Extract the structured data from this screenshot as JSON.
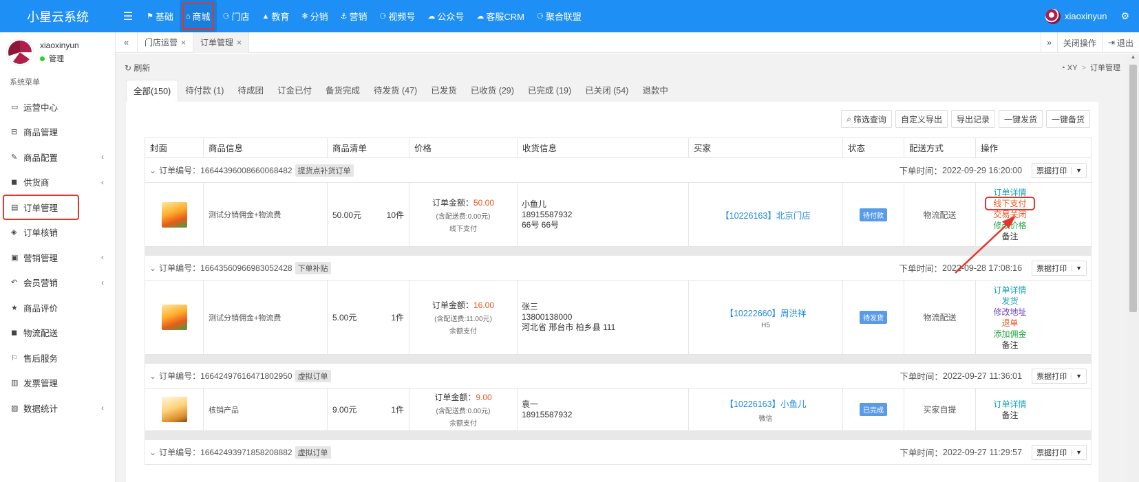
{
  "app": {
    "title": "小星云系统"
  },
  "topnav": [
    {
      "icon": "bookmark-icon",
      "glyph": "⚑",
      "label": "基础",
      "active": false
    },
    {
      "icon": "shop-icon",
      "glyph": "⌂",
      "label": "商城",
      "active": true
    },
    {
      "icon": "sitemap-icon",
      "glyph": "⚆",
      "label": "门店",
      "active": false
    },
    {
      "icon": "graduation-cap-icon",
      "glyph": "▲",
      "label": "教育",
      "active": false
    },
    {
      "icon": "snowflake-icon",
      "glyph": "✻",
      "label": "分销",
      "active": false
    },
    {
      "icon": "anchor-icon",
      "glyph": "⚓",
      "label": "营销",
      "active": false
    },
    {
      "icon": "sitemap-icon",
      "glyph": "⚆",
      "label": "视频号",
      "active": false
    },
    {
      "icon": "wechat-icon",
      "glyph": "☁",
      "label": "公众号",
      "active": false
    },
    {
      "icon": "chat-icon",
      "glyph": "☁",
      "label": "客服CRM",
      "active": false
    },
    {
      "icon": "sitemap-icon",
      "glyph": "⚆",
      "label": "聚合联盟",
      "active": false
    }
  ],
  "user": {
    "name": "xiaoxinyun",
    "role": "管理"
  },
  "sidebar": {
    "title": "系统菜单",
    "items": [
      {
        "icon": "monitor-icon",
        "glyph": "▭",
        "label": "运营中心",
        "has_children": false,
        "active": false
      },
      {
        "icon": "basket-icon",
        "glyph": "⊟",
        "label": "商品管理",
        "has_children": false,
        "active": false
      },
      {
        "icon": "pencil-icon",
        "glyph": "✎",
        "label": "商品配置",
        "has_children": true,
        "active": false
      },
      {
        "icon": "truck-icon",
        "glyph": "◼",
        "label": "供货商",
        "has_children": true,
        "active": false
      },
      {
        "icon": "file-icon",
        "glyph": "▤",
        "label": "订单管理",
        "has_children": false,
        "active": true
      },
      {
        "icon": "tag-icon",
        "glyph": "◈",
        "label": "订单核销",
        "has_children": false,
        "active": false
      },
      {
        "icon": "gift-icon",
        "glyph": "▣",
        "label": "营销管理",
        "has_children": true,
        "active": false
      },
      {
        "icon": "reply-icon",
        "glyph": "↶",
        "label": "会员营销",
        "has_children": true,
        "active": false
      },
      {
        "icon": "star-icon",
        "glyph": "★",
        "label": "商品评价",
        "has_children": false,
        "active": false
      },
      {
        "icon": "truck-icon",
        "glyph": "◼",
        "label": "物流配送",
        "has_children": false,
        "active": false
      },
      {
        "icon": "service-icon",
        "glyph": "⚐",
        "label": "售后服务",
        "has_children": false,
        "active": false
      },
      {
        "icon": "invoice-icon",
        "glyph": "▥",
        "label": "发票管理",
        "has_children": false,
        "active": false
      },
      {
        "icon": "bar-chart-icon",
        "glyph": "▨",
        "label": "数据统计",
        "has_children": true,
        "active": false
      }
    ]
  },
  "tabs": {
    "prev": "«",
    "next": "»",
    "items": [
      {
        "label": "门店运营",
        "close": "×",
        "current": false
      },
      {
        "label": "订单管理",
        "close": "×",
        "current": true
      }
    ],
    "close_ops": "关闭操作",
    "logout": "退出"
  },
  "page": {
    "refresh": "刷新",
    "breadcrumb": [
      "XY",
      "订单管理"
    ],
    "status_tabs": [
      "全部(150)",
      "待付款 (1)",
      "待成团",
      "订金已付",
      "备货完成",
      "待发货 (47)",
      "已发货",
      "已收货 (29)",
      "已完成 (19)",
      "已关闭 (54)",
      "退款中"
    ],
    "toolbar": [
      "筛选查询",
      "自定义导出",
      "导出记录",
      "一键发货",
      "一键备货"
    ],
    "columns": [
      "封面",
      "商品信息",
      "商品清单",
      "价格",
      "收货信息",
      "买家",
      "状态",
      "配送方式",
      "操作"
    ],
    "labels": {
      "order_no": "订单编号：",
      "order_time": "下单时间：",
      "amount": "订单金额：",
      "print": "票据打印"
    }
  },
  "orders": [
    {
      "no": "16644396008660068482",
      "tag": "提货点补货订单",
      "time": "2022-09-29 16:20:00",
      "thumb": "a",
      "product": "测试分销佣金+物流费",
      "unit_price": "50.00元",
      "qty": "10件",
      "amount": "50.00",
      "shipping": "(含配送费:0.00元)",
      "pay_method": "线下支付",
      "addr": [
        "小鱼儿",
        "18915587932",
        "66号 66号"
      ],
      "buyer": "【10226163】北京门店",
      "buyer_src": "",
      "status": "待付款",
      "status_color": "#5a9be8",
      "delivery": "物流配送",
      "ops": [
        {
          "label": "订单详情",
          "color": "#17a2b8",
          "hl": false
        },
        {
          "label": "线下支付",
          "color": "#f0541e",
          "hl": true
        },
        {
          "label": "交易关闭",
          "color": "#f0541e",
          "hl": false
        },
        {
          "label": "修改价格",
          "color": "#28a745",
          "hl": false
        },
        {
          "label": "备注",
          "color": "#333333",
          "hl": false
        }
      ],
      "height": 93
    },
    {
      "no": "16643560966983052428",
      "tag": "下单补贴",
      "time": "2022-09-28 17:08:16",
      "thumb": "a",
      "product": "测试分销佣金+物流费",
      "unit_price": "5.00元",
      "qty": "1件",
      "amount": "16.00",
      "shipping": "(含配送费:11.00元)",
      "pay_method": "余额支付",
      "addr": [
        "张三",
        "13800138000",
        "河北省 邢台市 柏乡县 111"
      ],
      "buyer": "【10222660】周洪祥",
      "buyer_src": "H5",
      "status": "待发货",
      "status_color": "#5a9be8",
      "delivery": "物流配送",
      "ops": [
        {
          "label": "订单详情",
          "color": "#17a2b8",
          "hl": false
        },
        {
          "label": "发货",
          "color": "#17a2b8",
          "hl": false
        },
        {
          "label": "修改地址",
          "color": "#6f42c1",
          "hl": false
        },
        {
          "label": "退单",
          "color": "#f0541e",
          "hl": false
        },
        {
          "label": "添加佣金",
          "color": "#28a745",
          "hl": false
        },
        {
          "label": "备注",
          "color": "#333333",
          "hl": false
        }
      ],
      "height": 108
    },
    {
      "no": "16642497616471802950",
      "tag": "虚拟订单",
      "time": "2022-09-27 11:36:01",
      "thumb": "b",
      "product": "核销产品",
      "unit_price": "9.00元",
      "qty": "1件",
      "amount": "9.00",
      "shipping": "(含配送费:0.00元)",
      "pay_method": "余额支付",
      "addr": [
        "袁一",
        "18915587932"
      ],
      "buyer": "【10226163】小鱼儿",
      "buyer_src": "微信",
      "status": "已完成",
      "status_color": "#5a9be8",
      "delivery": "买家自提",
      "ops": [
        {
          "label": "订单详情",
          "color": "#17a2b8",
          "hl": false
        },
        {
          "label": "备注",
          "color": "#333333",
          "hl": false
        }
      ],
      "height": 62
    },
    {
      "no": "16642493971858208882",
      "tag": "虚拟订单",
      "time": "2022-09-27 11:29:57",
      "thumb": "b",
      "product": "",
      "unit_price": "",
      "qty": "",
      "amount": "",
      "shipping": "",
      "pay_method": "",
      "addr": [],
      "buyer": "",
      "buyer_src": "",
      "status": "",
      "status_color": "#5a9be8",
      "delivery": "",
      "ops": [],
      "height": 0
    }
  ],
  "colors": {
    "primary": "#1e90f5",
    "highlight": "#e8322b",
    "amount": "#f0541e",
    "link": "#1e88e5"
  }
}
